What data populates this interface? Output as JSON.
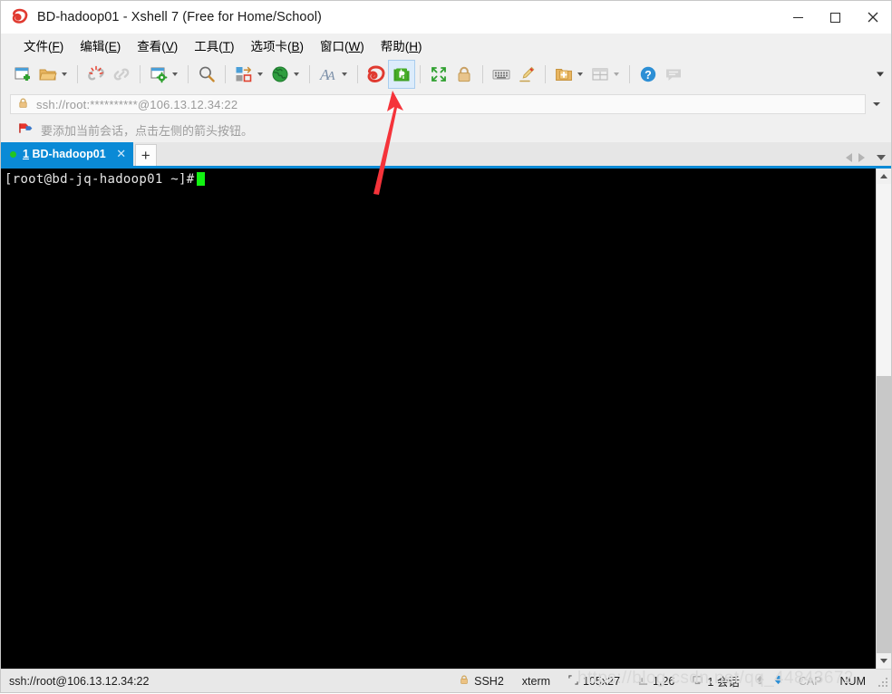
{
  "window": {
    "title": "BD-hadoop01 - Xshell 7 (Free for Home/School)",
    "logo_icon": "xshell-shell-logo-icon",
    "minimize_label": "—",
    "maximize_label": "□",
    "close_label": "✕"
  },
  "menubar": {
    "items": [
      {
        "name": "file",
        "text": "文件",
        "accel": "F"
      },
      {
        "name": "edit",
        "text": "编辑",
        "accel": "E"
      },
      {
        "name": "view",
        "text": "查看",
        "accel": "V"
      },
      {
        "name": "tools",
        "text": "工具",
        "accel": "T"
      },
      {
        "name": "tabs",
        "text": "选项卡",
        "accel": "B"
      },
      {
        "name": "window",
        "text": "窗口",
        "accel": "W"
      },
      {
        "name": "help",
        "text": "帮助",
        "accel": "H"
      }
    ]
  },
  "toolbar": {
    "overflow_label": "▾",
    "items": [
      {
        "name": "new-session-button",
        "icon": "new-window-plus-icon",
        "caret": false
      },
      {
        "name": "open-session-button",
        "icon": "open-folder-icon",
        "caret": true
      },
      {
        "name": "separator-1",
        "icon": "separator",
        "caret": false
      },
      {
        "name": "disconnect-button",
        "icon": "broken-link-icon",
        "caret": false
      },
      {
        "name": "reconnect-button",
        "icon": "chain-link-icon",
        "caret": false
      },
      {
        "name": "separator-2",
        "icon": "separator",
        "caret": false
      },
      {
        "name": "session-properties-button",
        "icon": "window-gear-icon",
        "caret": true
      },
      {
        "name": "separator-3",
        "icon": "separator",
        "caret": false
      },
      {
        "name": "find-button",
        "icon": "magnifier-icon",
        "caret": false
      },
      {
        "name": "separator-4",
        "icon": "separator",
        "caret": false
      },
      {
        "name": "layout-transfer-button",
        "icon": "blocks-swap-icon",
        "caret": true
      },
      {
        "name": "globe-button",
        "icon": "green-globe-icon",
        "caret": true
      },
      {
        "name": "separator-5",
        "icon": "separator",
        "caret": false
      },
      {
        "name": "font-button",
        "icon": "font-a-icon",
        "caret": true
      },
      {
        "name": "separator-6",
        "icon": "separator",
        "caret": false
      },
      {
        "name": "xshell-button",
        "icon": "red-shell-icon",
        "caret": false
      },
      {
        "name": "xftp-button",
        "icon": "green-xftp-icon",
        "caret": false,
        "highlighted": true
      },
      {
        "name": "separator-7",
        "icon": "separator",
        "caret": false
      },
      {
        "name": "fullscreen-button",
        "icon": "fullscreen-arrows-icon",
        "caret": false
      },
      {
        "name": "lock-button",
        "icon": "padlock-icon",
        "caret": false
      },
      {
        "name": "separator-8",
        "icon": "separator",
        "caret": false
      },
      {
        "name": "keyboard-button",
        "icon": "keyboard-icon",
        "caret": false
      },
      {
        "name": "highlight-button",
        "icon": "highlight-pen-icon",
        "caret": false
      },
      {
        "name": "separator-9",
        "icon": "separator",
        "caret": false
      },
      {
        "name": "add-folder-button",
        "icon": "folder-plus-icon",
        "caret": true
      },
      {
        "name": "panes-button",
        "icon": "split-panes-icon",
        "caret": true
      },
      {
        "name": "separator-10",
        "icon": "separator",
        "caret": false
      },
      {
        "name": "help-button",
        "icon": "blue-question-icon",
        "caret": false
      },
      {
        "name": "chat-button",
        "icon": "speech-bubble-icon",
        "caret": false
      }
    ]
  },
  "address_bar": {
    "lock_icon": "gold-padlock-icon",
    "value": "ssh://root:**********@106.13.12.34:22",
    "placeholder": "ssh://root:**********@106.13.12.34:22",
    "dropdown_icon": "chevron-down-icon"
  },
  "info_bar": {
    "icon": "arrow-flag-icon",
    "text": "要添加当前会话，点击左侧的箭头按钮。"
  },
  "tabs": {
    "items": [
      {
        "name": "tab-bd-hadoop01",
        "number": "1",
        "label": "BD-hadoop01",
        "connected": true,
        "active": true,
        "close_label": "✕"
      }
    ],
    "new_tab_label": "+",
    "scroll_left_icon": "triangle-left-icon",
    "scroll_right_icon": "triangle-right-icon",
    "list_icon": "chevron-down-icon"
  },
  "terminal": {
    "prompt": "[root@bd-jq-hadoop01 ~]#",
    "cursor": "block-cursor",
    "background": "#000000",
    "foreground": "#e6e6e6",
    "cursor_color": "#12f312"
  },
  "scrollbar": {
    "up_icon": "scroll-up-arrow-icon",
    "down_icon": "scroll-down-arrow-icon",
    "thumb": "scrollbar-thumb"
  },
  "status_bar": {
    "connection": "ssh://root@106.13.12.34:22",
    "protocol": "SSH2",
    "protocol_icon": "gold-padlock-icon",
    "terminal_type": "xterm",
    "size_icon": "screen-size-icon",
    "size": "105x27",
    "cursor_icon": "cursor-pos-icon",
    "cursor_pos": "1,26",
    "sessions_icon": "session-count-icon",
    "sessions": "1 会话",
    "up_arrow_icon": "transfer-up-arrow-icon",
    "down_arrow_icon": "transfer-down-arrow-icon",
    "caps": "CAP",
    "num": "NUM"
  },
  "watermark": {
    "text": "https://blog.csdn.net/qq_44843672"
  },
  "annotation": {
    "arrow_color": "#f5333a",
    "points_to": "green-xftp-icon"
  },
  "colors": {
    "accent_blue": "#0a8ad6",
    "highlight_green": "#3ea022",
    "chrome_grey": "#f0f0f0",
    "terminal_black": "#000000"
  }
}
